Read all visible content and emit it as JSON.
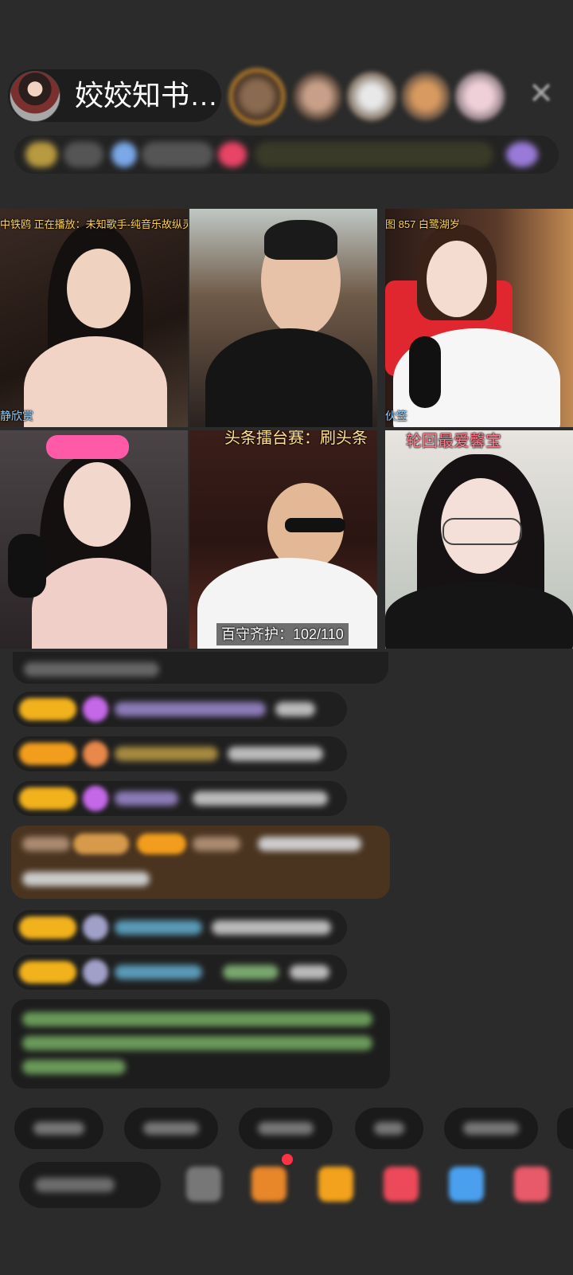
{
  "host": {
    "name": "姣姣知书…"
  },
  "close_icon": "close-icon",
  "video_grid": {
    "cells": [
      {
        "caption_top": "中铁鸥 正在播放：未知歌手-纯音乐故纵灵感",
        "caption_bottom": "静欣赏"
      },
      {
        "caption_top": "",
        "caption_bottom": ""
      },
      {
        "caption_top": "图 857 白鹭湖岁",
        "caption_bottom": "伙签"
      },
      {
        "caption_top": "",
        "caption_bottom": ""
      },
      {
        "caption_top": "头条擂台赛：刷头条",
        "caption_bottom": "百守齐护：102/110"
      },
      {
        "caption_top": "轮回最爱馨宝",
        "caption_bottom": ""
      }
    ]
  },
  "colors": {
    "background": "#2b2b2b",
    "badge_gold": "#f2b21c",
    "accent_orange": "#d4902f",
    "caption_yellow": "#ffd34d",
    "caption_pink": "#ff7b8e"
  }
}
